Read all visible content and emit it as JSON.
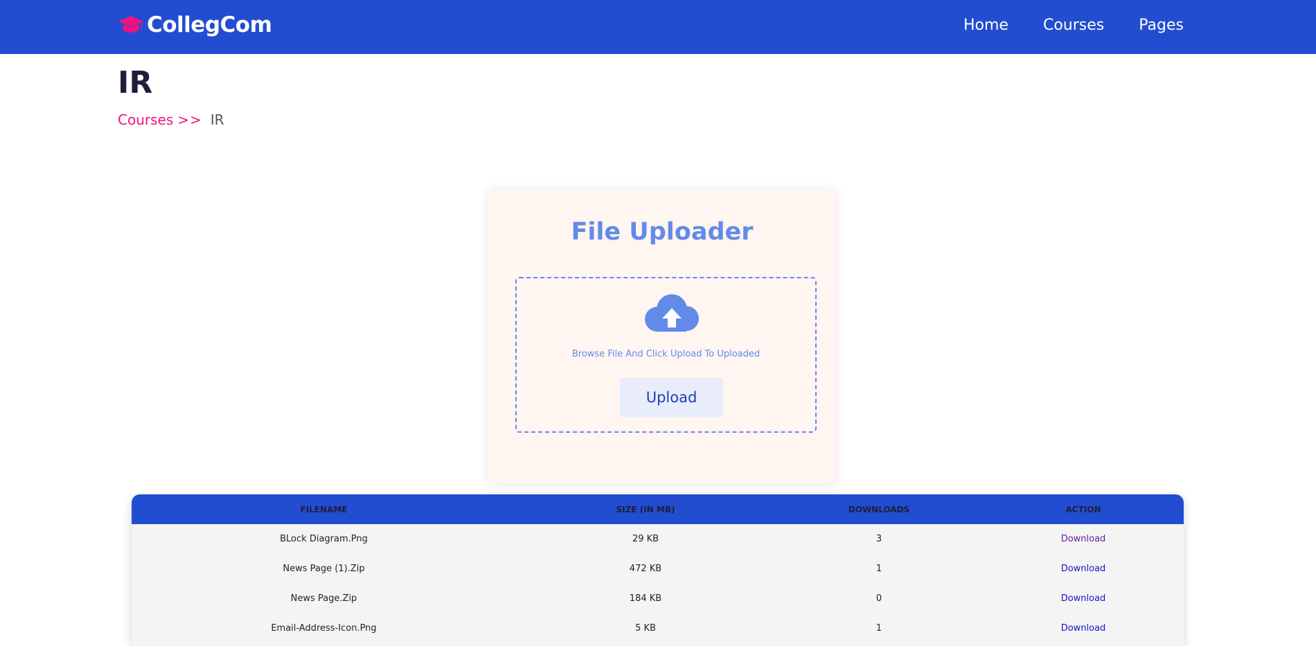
{
  "brand": {
    "name": "CollegCom"
  },
  "nav": {
    "links": [
      {
        "label": "Home"
      },
      {
        "label": "Courses"
      },
      {
        "label": "Pages"
      }
    ]
  },
  "page": {
    "title": "IR",
    "breadcrumb": {
      "parent": "Courses",
      "separator": ">>",
      "current": "IR"
    }
  },
  "uploader": {
    "title": "File Uploader",
    "hint": "Browse File And Click Upload To Uploaded",
    "button_label": "Upload",
    "icon": "cloud-upload-icon"
  },
  "files_table": {
    "headers": [
      "FILENAME",
      "SIZE (IN MB)",
      "DOWNLOADS",
      "ACTION"
    ],
    "rows": [
      {
        "filename": "BLock Diagram.Png",
        "size": "29 KB",
        "downloads": "3",
        "action": "Download",
        "visited": true
      },
      {
        "filename": "News Page (1).Zip",
        "size": "472 KB",
        "downloads": "1",
        "action": "Download",
        "visited": false
      },
      {
        "filename": "News Page.Zip",
        "size": "184 KB",
        "downloads": "0",
        "action": "Download",
        "visited": false
      },
      {
        "filename": "Email-Address-Icon.Png",
        "size": "5 KB",
        "downloads": "1",
        "action": "Download",
        "visited": false
      }
    ]
  },
  "colors": {
    "navbar": "#234dd1",
    "accent_pink": "#f0137e",
    "uploader_blue": "#628be9",
    "card_bg": "#fff5f1",
    "link_blue": "#1a13c9",
    "link_visited": "#6a1e9c"
  }
}
